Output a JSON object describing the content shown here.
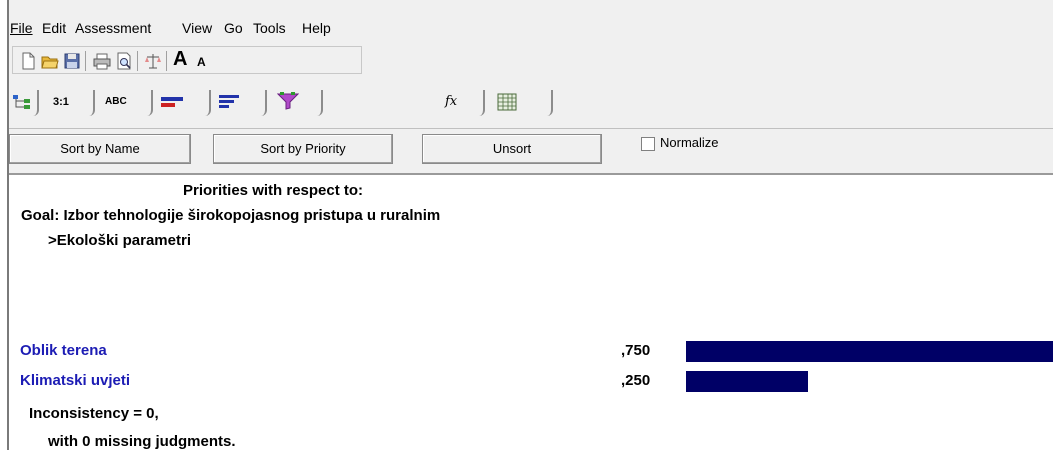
{
  "menu": {
    "file": "File",
    "edit": "Edit",
    "assessment": "Assessment",
    "view": "View",
    "go": "Go",
    "tools": "Tools",
    "help": "Help"
  },
  "toolbar": {
    "icons": [
      "new-document-icon",
      "open-folder-icon",
      "save-icon",
      "print-icon",
      "print-preview-icon",
      "balance-icon",
      "font-increase-icon",
      "font-decrease-icon"
    ],
    "font_increase_glyph": "A",
    "font_decrease_glyph": "A"
  },
  "tabs": {
    "ratio_label": "3:1",
    "abc_label": "ABC",
    "fx_label": "fx"
  },
  "sortbar": {
    "sort_by_name": "Sort by Name",
    "sort_by_priority": "Sort by Priority",
    "unsort": "Unsort",
    "normalize": "Normalize",
    "normalize_checked": false
  },
  "content": {
    "heading": "Priorities with respect to:",
    "goal": "Goal: Izbor tehnologije širokopojasnog pristupa u ruralnim",
    "node": ">Ekološki parametri",
    "rows": [
      {
        "label": "Oblik terena",
        "value_text": ",750",
        "value": 0.75
      },
      {
        "label": "Klimatski uvjeti",
        "value_text": ",250",
        "value": 0.25
      }
    ],
    "inconsistency": "Inconsistency = 0,",
    "missing": "with 0  missing judgments."
  },
  "colors": {
    "bar": "#000066",
    "row_label": "#1c1cb4",
    "chrome": "#f0f0f0"
  }
}
